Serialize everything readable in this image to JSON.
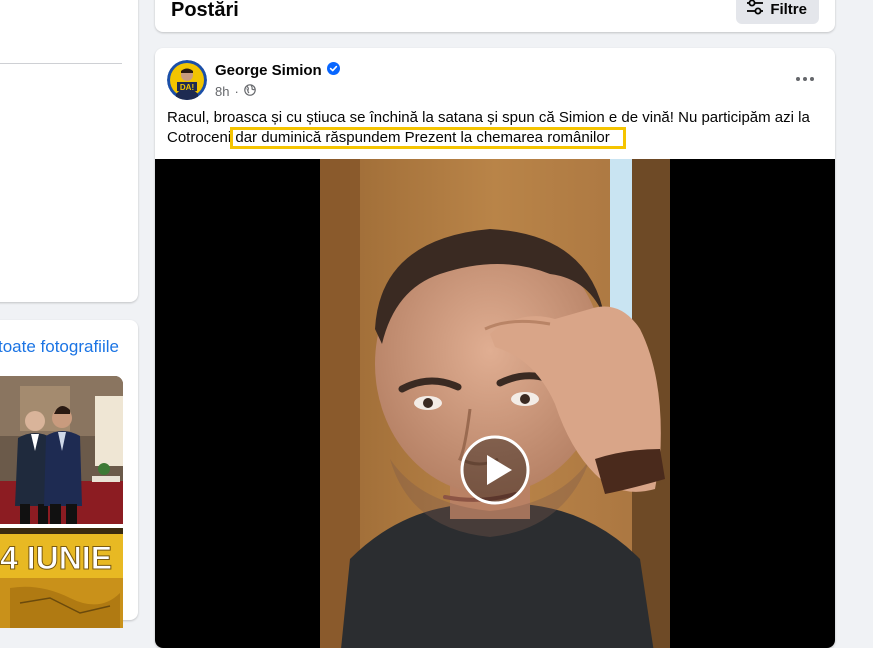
{
  "left_panel": {
    "see_all_photos_link": "toate fotografiile",
    "photo_banner_text": "4 IUNIE"
  },
  "posts_header": {
    "title": "Postări",
    "filters_label": "Filtre",
    "filters_icon": "sliders-icon"
  },
  "post": {
    "author": "George Simion",
    "verified": true,
    "time": "8h",
    "audience_icon": "globe-icon",
    "avatar_text": "DA!",
    "text_line1": "Racul, broasca și cu știuca se închină la satana și spun că Simion e de vină! Nu participăm azi la",
    "text_line2": "Cotroceni dar duminică răspundem Prezent la chemarea românilor",
    "highlight_color": "#f5c400"
  },
  "colors": {
    "accent": "#1b74e4",
    "verified_badge": "#0866ff",
    "background": "#f0f2f5"
  }
}
